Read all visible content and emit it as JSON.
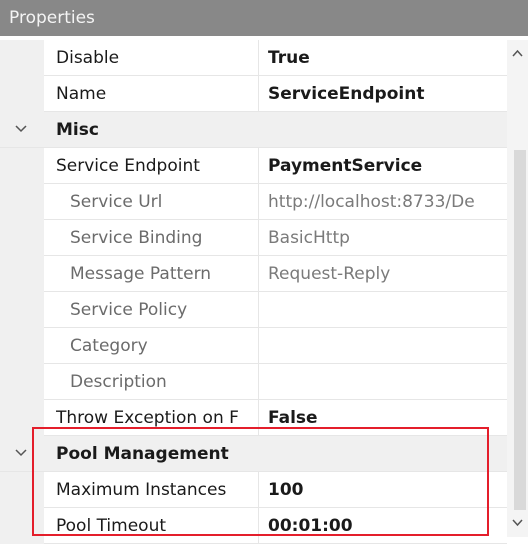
{
  "panel_title": "Properties",
  "rows": {
    "disable": {
      "name": "Disable",
      "value": "True"
    },
    "name": {
      "name": "Name",
      "value": "ServiceEndpoint"
    },
    "misc": {
      "label": "Misc"
    },
    "service_endpoint": {
      "name": "Service Endpoint",
      "value": "PaymentService"
    },
    "service_url": {
      "name": "Service Url",
      "value": "http://localhost:8733/De"
    },
    "service_binding": {
      "name": "Service Binding",
      "value": "BasicHttp"
    },
    "message_pattern": {
      "name": "Message Pattern",
      "value": "Request-Reply"
    },
    "service_policy": {
      "name": "Service Policy",
      "value": ""
    },
    "category": {
      "name": "Category",
      "value": ""
    },
    "description": {
      "name": "Description",
      "value": ""
    },
    "throw_exception": {
      "name": "Throw Exception on F",
      "value": "False"
    },
    "pool_management": {
      "label": "Pool Management"
    },
    "maximum_instances": {
      "name": "Maximum Instances",
      "value": "100"
    },
    "pool_timeout": {
      "name": "Pool Timeout",
      "value": "00:01:00"
    }
  },
  "colors": {
    "highlight": "#e41e2b",
    "header_bg": "#888888"
  },
  "icons": {
    "category_toggle": "chevron-down-icon",
    "scroll_up": "scroll-up-arrow",
    "scroll_down": "scroll-down-arrow"
  }
}
